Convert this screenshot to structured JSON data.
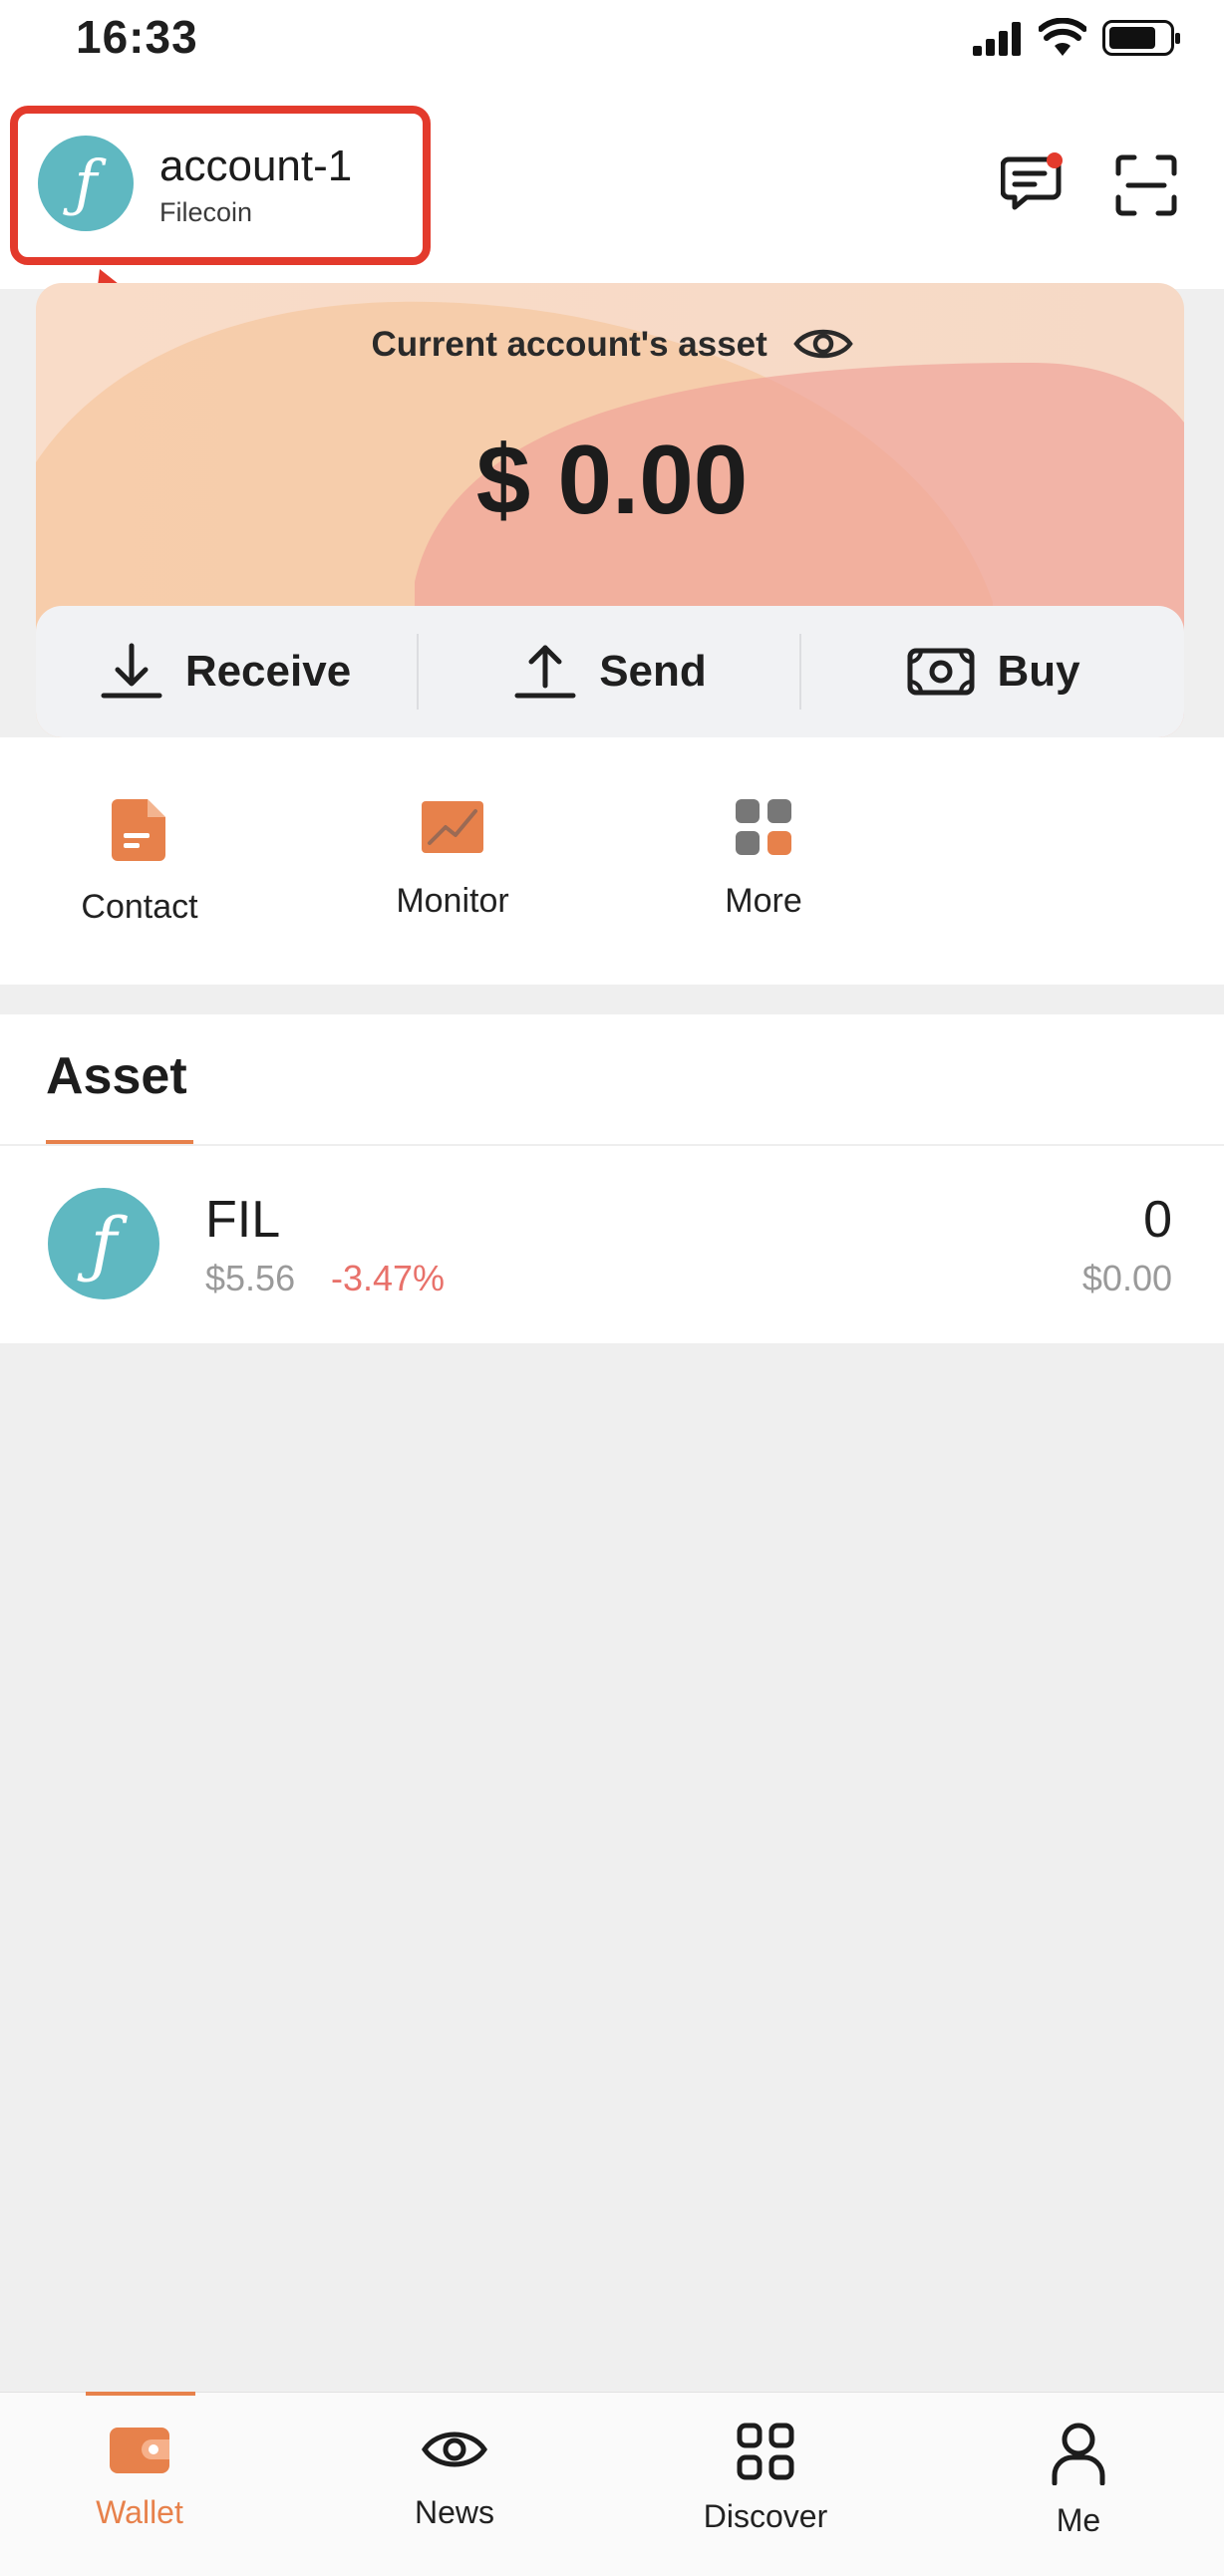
{
  "status_bar": {
    "time": "16:33"
  },
  "header": {
    "account_name": "account-1",
    "chain_name": "Filecoin",
    "chain_symbol": "ƒ"
  },
  "asset_card": {
    "label": "Current account's asset",
    "total_value": "$ 0.00",
    "actions": [
      {
        "label": "Receive",
        "icon": "download-icon"
      },
      {
        "label": "Send",
        "icon": "upload-icon"
      },
      {
        "label": "Buy",
        "icon": "cash-icon"
      }
    ]
  },
  "quick_links": [
    {
      "label": "Contact",
      "icon": "document-icon"
    },
    {
      "label": "Monitor",
      "icon": "chart-icon"
    },
    {
      "label": "More",
      "icon": "grid-icon"
    }
  ],
  "asset_section": {
    "title": "Asset",
    "items": [
      {
        "symbol": "FIL",
        "price": "$5.56",
        "change": "-3.47%",
        "amount": "0",
        "value": "$0.00",
        "icon_glyph": "ƒ"
      }
    ]
  },
  "tabs": [
    {
      "label": "Wallet",
      "icon": "wallet-icon",
      "active": true
    },
    {
      "label": "News",
      "icon": "eye-icon",
      "active": false
    },
    {
      "label": "Discover",
      "icon": "grid-icon",
      "active": false
    },
    {
      "label": "Me",
      "icon": "person-icon",
      "active": false
    }
  ],
  "colors": {
    "accent": "#e7814b",
    "filecoin": "#5fb8c1",
    "negative": "#e8716a",
    "highlight": "#e33a2c"
  }
}
